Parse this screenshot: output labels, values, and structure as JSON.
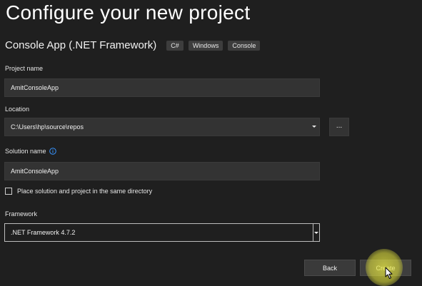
{
  "header": {
    "title": "Configure your new project",
    "project_type": "Console App (.NET Framework)",
    "tags": [
      "C#",
      "Windows",
      "Console"
    ]
  },
  "form": {
    "project_name_label": "Project name",
    "project_name_value": "AmitConsoleApp",
    "location_label": "Location",
    "location_value": "C:\\Users\\hp\\source\\repos",
    "browse_label": "...",
    "solution_name_label": "Solution name",
    "solution_name_value": "AmitConsoleApp",
    "same_dir_label": "Place solution and project in the same directory",
    "same_dir_checked": false,
    "framework_label": "Framework",
    "framework_value": ".NET Framework 4.7.2"
  },
  "footer": {
    "back_label": "Back",
    "create_label": "Create"
  },
  "colors": {
    "background": "#1f1f1f",
    "field": "#333333",
    "tag": "#3d3d3d",
    "info_icon": "#3794ff",
    "highlight": "#e6e646"
  },
  "icons": {
    "info": "info-icon",
    "location_dropdown": "chevron-down-icon",
    "framework_dropdown": "chevron-down-icon",
    "cursor": "mouse-pointer-icon"
  }
}
